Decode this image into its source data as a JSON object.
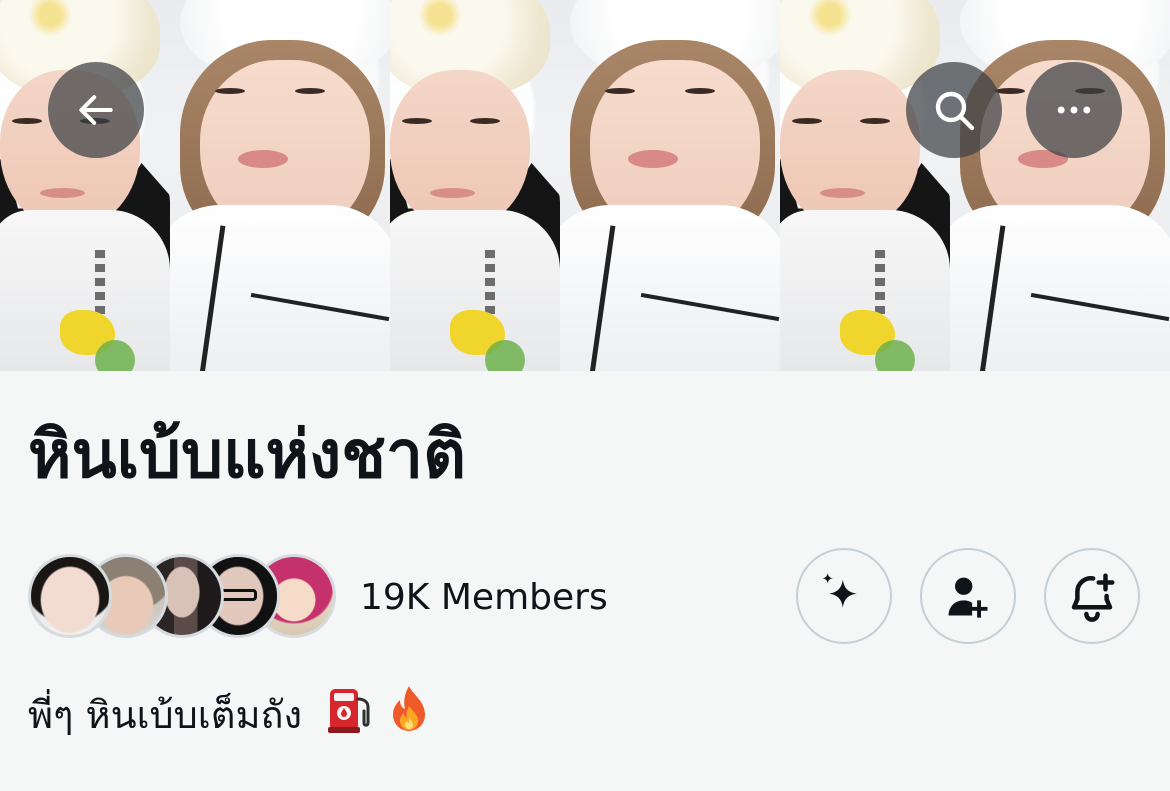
{
  "header": {
    "back_icon": "arrow-left-icon",
    "search_icon": "search-icon",
    "more_icon": "more-horizontal-icon"
  },
  "community": {
    "title": "หินเบ้บแห่งชาติ",
    "members_label": "19K Members",
    "bio_text": "พี่ๆ หินเบ้บเต็มถัง",
    "bio_emojis": [
      "fuel-pump-emoji",
      "fire-emoji"
    ]
  },
  "actions": {
    "sparkle_icon": "sparkle-icon",
    "follow_icon": "add-person-icon",
    "bell_icon": "bell-plus-icon"
  },
  "colors": {
    "background": "#f5f7f7",
    "text": "#0f1419",
    "button_border": "#c4cfd6",
    "overlay_button": "#3c4044"
  }
}
